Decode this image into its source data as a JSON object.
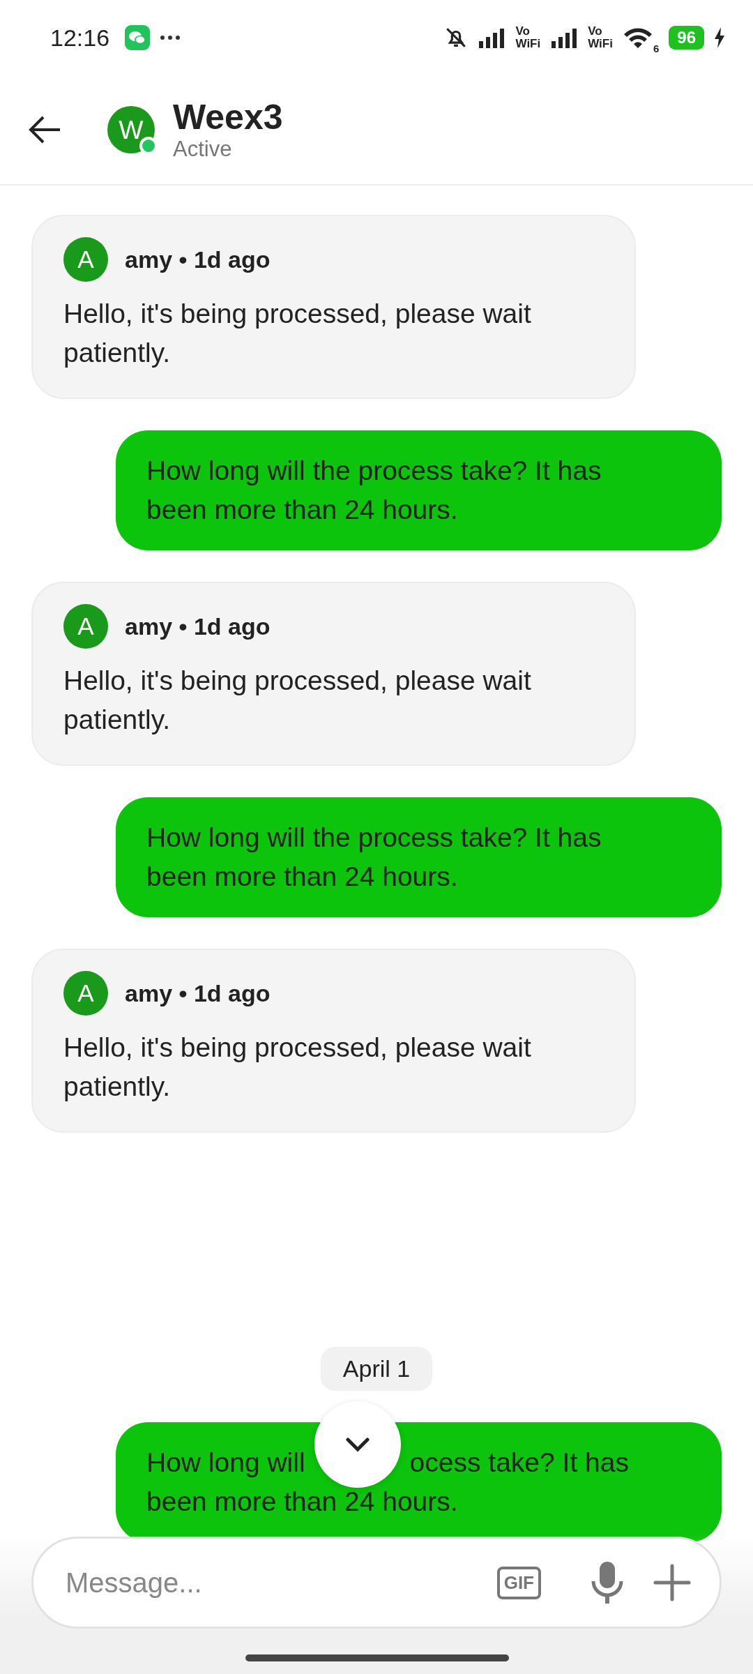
{
  "status_bar": {
    "time": "12:16",
    "network_labels": [
      {
        "top": "Vo",
        "bottom": "WiFi"
      },
      {
        "top": "Vo",
        "bottom": "WiFi"
      }
    ],
    "wifi_label": "6",
    "battery": "96"
  },
  "header": {
    "avatar_letter": "W",
    "title": "Weex3",
    "status": "Active",
    "online": true
  },
  "messages": [
    {
      "kind": "received",
      "avatar_letter": "A",
      "author": "amy",
      "separator": "•",
      "time": "1d ago",
      "text": "Hello, it's being processed, please wait patiently."
    },
    {
      "kind": "sent",
      "text": "How long will the process take? It has been more than 24 hours."
    },
    {
      "kind": "received",
      "avatar_letter": "A",
      "author": "amy",
      "separator": "•",
      "time": "1d ago",
      "text": "Hello, it's being processed, please wait patiently."
    },
    {
      "kind": "sent",
      "text": "How long will the process take? It has been more than 24 hours."
    },
    {
      "kind": "received",
      "avatar_letter": "A",
      "author": "amy",
      "separator": "•",
      "time": "1d ago",
      "text": "Hello, it's being processed, please wait patiently."
    },
    {
      "kind": "date",
      "text": "April 1"
    },
    {
      "kind": "sent_covered",
      "segments": [
        "How long will",
        "ocess take? It has",
        "been more than 24 hours."
      ]
    }
  ],
  "composer": {
    "placeholder": "Message...",
    "gif_label": "GIF"
  }
}
